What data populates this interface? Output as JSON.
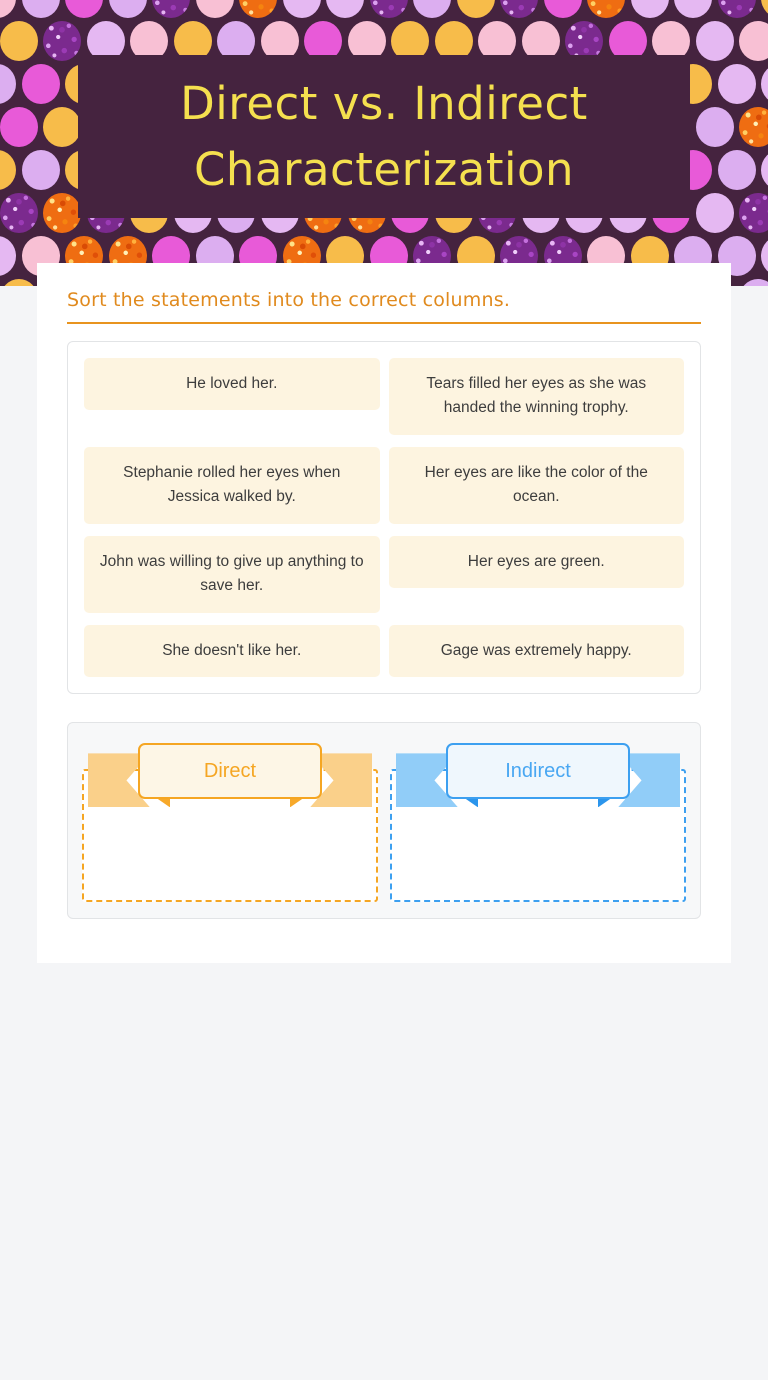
{
  "header": {
    "title": "Direct vs. Indirect Characterization",
    "title_line1": "Direct vs. Indirect",
    "title_line2": "Characterization",
    "background_color": "#45233f",
    "title_color": "#f5e04f"
  },
  "instructions": {
    "text": "Sort the statements into the correct columns.",
    "color": "#e08a1e"
  },
  "statements": [
    {
      "text": "He loved her."
    },
    {
      "text": "Tears filled her eyes as she was handed the winning trophy."
    },
    {
      "text": "Stephanie rolled her eyes when Jessica walked by."
    },
    {
      "text": "Her eyes are like the color of the ocean."
    },
    {
      "text": "John was willing to give up anything to save her."
    },
    {
      "text": "Her eyes are green."
    },
    {
      "text": "She doesn't like her."
    },
    {
      "text": "Gage was extremely happy."
    }
  ],
  "dropzones": [
    {
      "label": "Direct",
      "accent_color": "#f5a623",
      "items": []
    },
    {
      "label": "Indirect",
      "accent_color": "#3da0f0",
      "items": []
    }
  ],
  "theme": {
    "page_background": "#f4f5f7",
    "panel_background": "#ffffff",
    "card_background": "#fdf4e0",
    "card_text_color": "#3d3d3d",
    "dropzone_panel_background": "#f7f8f9"
  },
  "pattern": {
    "dot_colors": [
      "#e5b8f2",
      "#f8c0d4",
      "#e85ad8",
      "#f7bc4a",
      "#dcaef0"
    ],
    "glitter_purple": "#7b2a8e",
    "glitter_orange": "#ef6d12"
  }
}
